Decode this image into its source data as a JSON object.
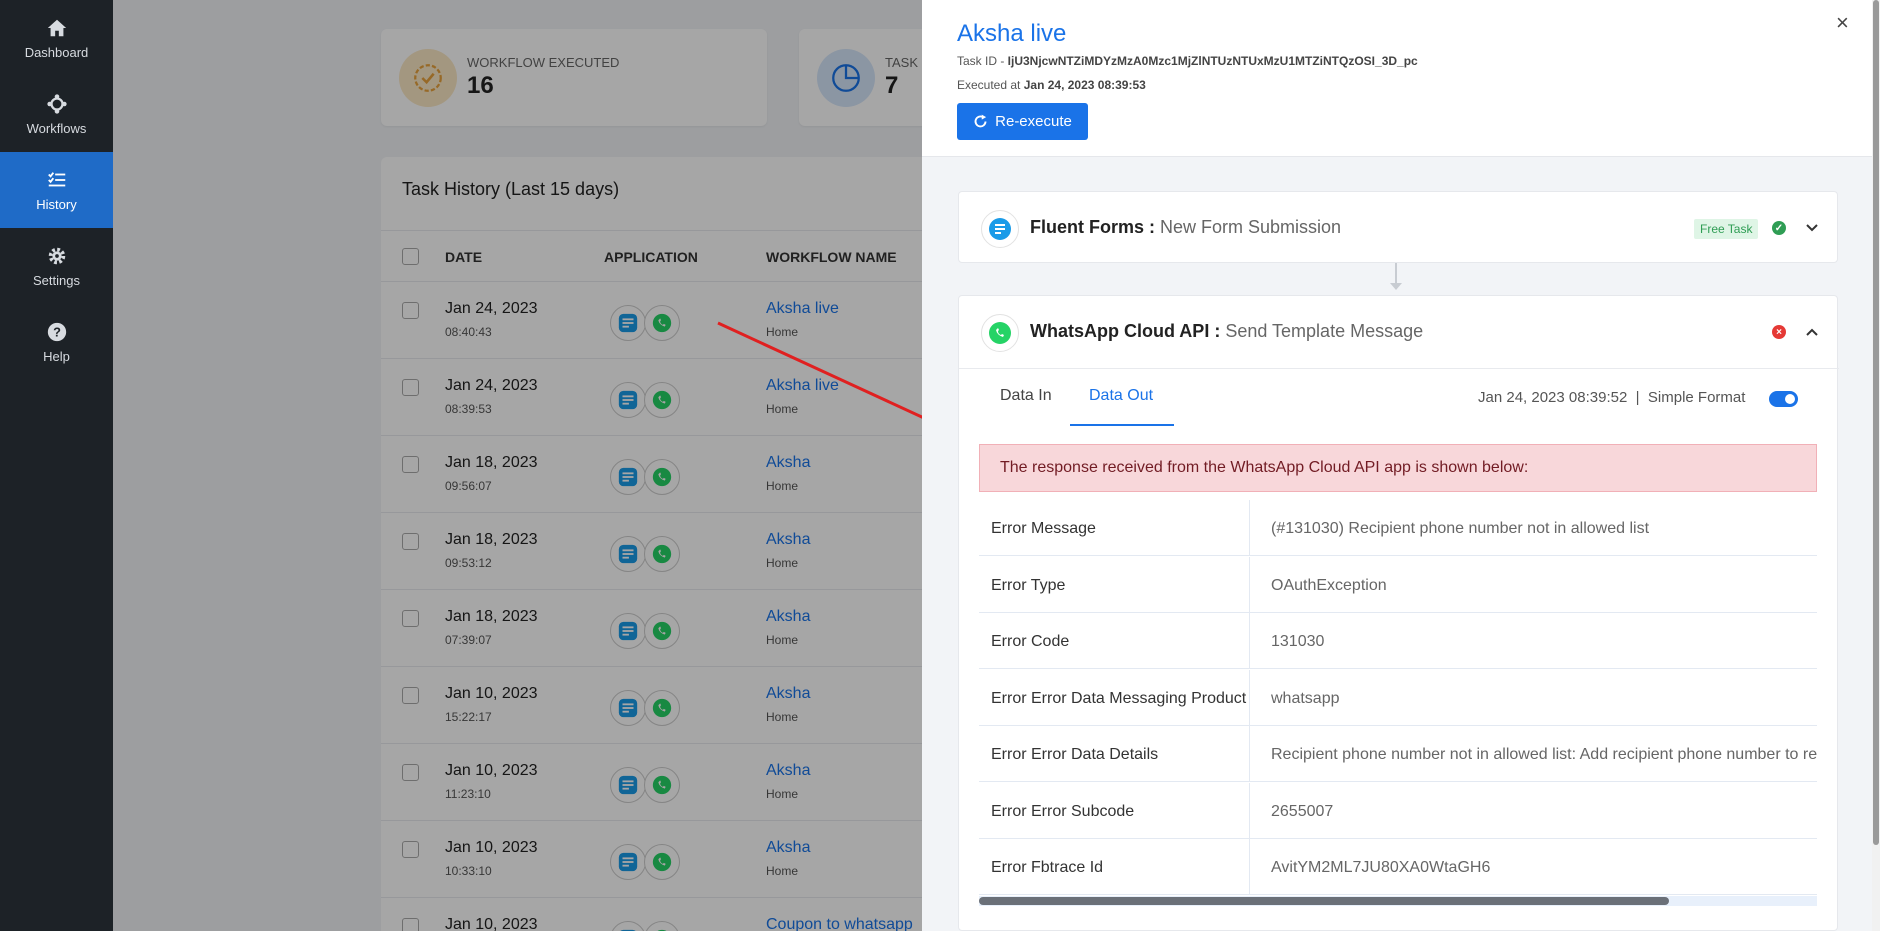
{
  "sidebar": {
    "items": [
      {
        "label": "Dashboard",
        "icon": "home-icon"
      },
      {
        "label": "Workflows",
        "icon": "workflow-icon"
      },
      {
        "label": "History",
        "icon": "list-check-icon",
        "active": true
      },
      {
        "label": "Settings",
        "icon": "gear-icon"
      },
      {
        "label": "Help",
        "icon": "question-icon"
      }
    ]
  },
  "stats": {
    "executed": {
      "title": "WORKFLOW EXECUTED",
      "value": "16"
    },
    "task": {
      "title": "TASK C",
      "value": "7"
    }
  },
  "history": {
    "title": "Task History (Last 15 days)",
    "columns": {
      "date": "DATE",
      "application": "APPLICATION",
      "workflow": "WORKFLOW NAME"
    },
    "rows": [
      {
        "date": "Jan 24, 2023",
        "time": "08:40:43",
        "name": "Aksha live",
        "sub": "Home"
      },
      {
        "date": "Jan 24, 2023",
        "time": "08:39:53",
        "name": "Aksha live",
        "sub": "Home"
      },
      {
        "date": "Jan 18, 2023",
        "time": "09:56:07",
        "name": "Aksha",
        "sub": "Home"
      },
      {
        "date": "Jan 18, 2023",
        "time": "09:53:12",
        "name": "Aksha",
        "sub": "Home"
      },
      {
        "date": "Jan 18, 2023",
        "time": "07:39:07",
        "name": "Aksha",
        "sub": "Home"
      },
      {
        "date": "Jan 10, 2023",
        "time": "15:22:17",
        "name": "Aksha",
        "sub": "Home"
      },
      {
        "date": "Jan 10, 2023",
        "time": "11:23:10",
        "name": "Aksha",
        "sub": "Home"
      },
      {
        "date": "Jan 10, 2023",
        "time": "10:33:10",
        "name": "Aksha",
        "sub": "Home"
      },
      {
        "date": "Jan 10, 2023",
        "time": "",
        "name": "Coupon to whatsapp",
        "sub": ""
      }
    ]
  },
  "drawer": {
    "title": "Aksha live",
    "task_id_label": "Task ID - ",
    "task_id": "IjU3NjcwNTZiMDYzMzA0Mzc1MjZlNTUzNTUxMzU1MTZiNTQzOSI_3D_pc",
    "executed_label": "Executed at ",
    "executed_at": "Jan 24, 2023 08:39:53",
    "reexecute_label": "Re-execute",
    "close_glyph": "×",
    "trigger": {
      "app": "Fluent Forms",
      "sep": " : ",
      "event": "New Form Submission",
      "badge": "Free Task",
      "status": "success"
    },
    "action": {
      "app": "WhatsApp Cloud API",
      "sep": " : ",
      "event": "Send Template Message",
      "status": "error",
      "tabs": [
        "Data In",
        "Data Out"
      ],
      "active_tab": "Data Out",
      "timestamp": "Jan 24, 2023 08:39:52",
      "divider": "|",
      "format_label": "Simple Format",
      "alert": "The response received from the WhatsApp Cloud API app is shown below:",
      "fields": [
        {
          "key": "Error Message",
          "value": "(#131030) Recipient phone number not in allowed list"
        },
        {
          "key": "Error Type",
          "value": "OAuthException"
        },
        {
          "key": "Error Code",
          "value": "131030"
        },
        {
          "key": "Error Error Data Messaging Product",
          "value": "whatsapp"
        },
        {
          "key": "Error Error Data Details",
          "value": "Recipient phone number not in allowed list: Add recipient phone number to rec"
        },
        {
          "key": "Error Error Subcode",
          "value": "2655007"
        },
        {
          "key": "Error Fbtrace Id",
          "value": "AvitYM2ML7JU80XA0WtaGH6"
        }
      ]
    }
  },
  "colors": {
    "accent": "#1a73e8",
    "sidebar": "#1d2227",
    "error": "#e53935",
    "success": "#2f9d54",
    "arrow": "#e02020"
  }
}
